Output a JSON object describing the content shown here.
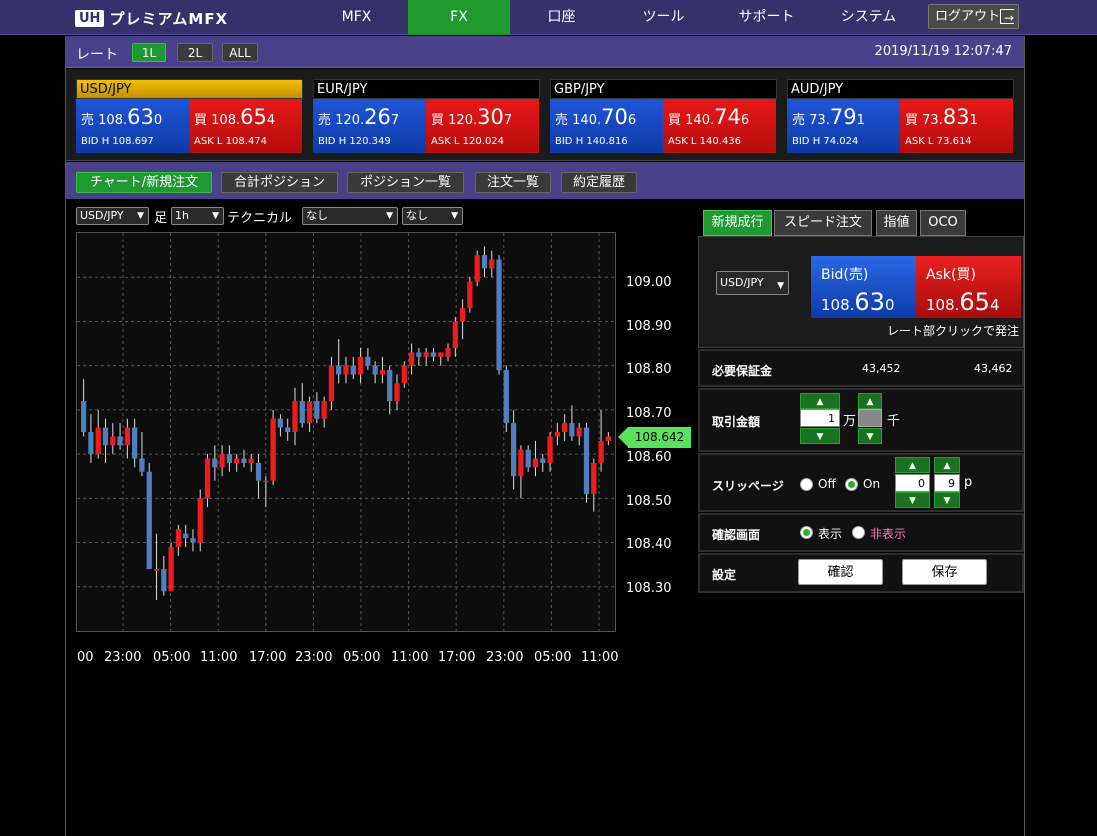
{
  "app": {
    "logo_badge": "UH",
    "logo_text": "プレミアムMFX"
  },
  "topnav": {
    "tabs": [
      {
        "label": "MFX"
      },
      {
        "label": "FX"
      },
      {
        "label": "口座"
      },
      {
        "label": "ツール"
      },
      {
        "label": "サポート"
      },
      {
        "label": "システム"
      }
    ],
    "active": "FX",
    "logout_label": "ログアウト"
  },
  "ratebar": {
    "label": "レート",
    "modes": [
      "1L",
      "2L",
      "ALL"
    ],
    "active_mode": "1L",
    "datetime": "2019/11/19 12:07:47"
  },
  "rates": [
    {
      "pair": "USD/JPY",
      "selected": true,
      "sell": {
        "prefix": "売",
        "head": "108.",
        "big": "63",
        "tail": "0"
      },
      "buy": {
        "prefix": "買",
        "head": "108.",
        "big": "65",
        "tail": "4"
      },
      "bid_high": "BID H 108.697",
      "ask_low": "ASK L 108.474"
    },
    {
      "pair": "EUR/JPY",
      "selected": false,
      "sell": {
        "prefix": "売",
        "head": "120.",
        "big": "26",
        "tail": "7"
      },
      "buy": {
        "prefix": "買",
        "head": "120.",
        "big": "30",
        "tail": "7"
      },
      "bid_high": "BID H 120.349",
      "ask_low": "ASK L 120.024"
    },
    {
      "pair": "GBP/JPY",
      "selected": false,
      "sell": {
        "prefix": "売",
        "head": "140.",
        "big": "70",
        "tail": "6"
      },
      "buy": {
        "prefix": "買",
        "head": "140.",
        "big": "74",
        "tail": "6"
      },
      "bid_high": "BID H 140.816",
      "ask_low": "ASK L 140.436"
    },
    {
      "pair": "AUD/JPY",
      "selected": false,
      "sell": {
        "prefix": "売",
        "head": "73.",
        "big": "79",
        "tail": "1"
      },
      "buy": {
        "prefix": "買",
        "head": "73.",
        "big": "83",
        "tail": "1"
      },
      "bid_high": "BID H 74.024",
      "ask_low": "ASK L 73.614"
    }
  ],
  "subnav": {
    "tabs": [
      "チャート/新規注文",
      "合計ポジション",
      "ポジション一覧",
      "注文一覧",
      "約定履歴"
    ],
    "active": "チャート/新規注文"
  },
  "chart_controls": {
    "pair": "USD/JPY",
    "bar_label": "足",
    "timeframe": "1h",
    "technical_label": "テクニカル",
    "technical_1": "なし",
    "technical_2": "なし"
  },
  "chart_data": {
    "type": "candlestick",
    "y_ticks": [
      "109.00",
      "108.90",
      "108.80",
      "108.70",
      "108.60",
      "108.50",
      "108.40",
      "108.30"
    ],
    "x_ticks": [
      "00",
      "23:00",
      "05:00",
      "11:00",
      "17:00",
      "23:00",
      "05:00",
      "11:00",
      "17:00",
      "23:00",
      "05:00",
      "11:00"
    ],
    "ylim": [
      108.2,
      109.1
    ],
    "current_price": "108.642",
    "candles": [
      {
        "o": 108.72,
        "h": 108.77,
        "l": 108.64,
        "c": 108.65
      },
      {
        "o": 108.65,
        "h": 108.69,
        "l": 108.58,
        "c": 108.6
      },
      {
        "o": 108.6,
        "h": 108.7,
        "l": 108.59,
        "c": 108.66
      },
      {
        "o": 108.66,
        "h": 108.68,
        "l": 108.58,
        "c": 108.62
      },
      {
        "o": 108.62,
        "h": 108.67,
        "l": 108.6,
        "c": 108.64
      },
      {
        "o": 108.64,
        "h": 108.67,
        "l": 108.61,
        "c": 108.62
      },
      {
        "o": 108.62,
        "h": 108.68,
        "l": 108.59,
        "c": 108.66
      },
      {
        "o": 108.66,
        "h": 108.68,
        "l": 108.57,
        "c": 108.59
      },
      {
        "o": 108.59,
        "h": 108.65,
        "l": 108.55,
        "c": 108.56
      },
      {
        "o": 108.56,
        "h": 108.58,
        "l": 108.34,
        "c": 108.34
      },
      {
        "o": 108.34,
        "h": 108.42,
        "l": 108.27,
        "c": 108.34
      },
      {
        "o": 108.34,
        "h": 108.37,
        "l": 108.28,
        "c": 108.29
      },
      {
        "o": 108.29,
        "h": 108.4,
        "l": 108.29,
        "c": 108.39
      },
      {
        "o": 108.39,
        "h": 108.44,
        "l": 108.37,
        "c": 108.43
      },
      {
        "o": 108.42,
        "h": 108.44,
        "l": 108.39,
        "c": 108.41
      },
      {
        "o": 108.41,
        "h": 108.43,
        "l": 108.38,
        "c": 108.4
      },
      {
        "o": 108.4,
        "h": 108.52,
        "l": 108.38,
        "c": 108.5
      },
      {
        "o": 108.5,
        "h": 108.6,
        "l": 108.48,
        "c": 108.59
      },
      {
        "o": 108.59,
        "h": 108.62,
        "l": 108.54,
        "c": 108.57
      },
      {
        "o": 108.57,
        "h": 108.62,
        "l": 108.55,
        "c": 108.6
      },
      {
        "o": 108.6,
        "h": 108.62,
        "l": 108.56,
        "c": 108.58
      },
      {
        "o": 108.58,
        "h": 108.6,
        "l": 108.56,
        "c": 108.59
      },
      {
        "o": 108.59,
        "h": 108.61,
        "l": 108.57,
        "c": 108.58
      },
      {
        "o": 108.58,
        "h": 108.6,
        "l": 108.56,
        "c": 108.59
      },
      {
        "o": 108.58,
        "h": 108.6,
        "l": 108.5,
        "c": 108.54
      },
      {
        "o": 108.54,
        "h": 108.55,
        "l": 108.48,
        "c": 108.54
      },
      {
        "o": 108.54,
        "h": 108.7,
        "l": 108.53,
        "c": 108.68
      },
      {
        "o": 108.68,
        "h": 108.69,
        "l": 108.64,
        "c": 108.66
      },
      {
        "o": 108.66,
        "h": 108.68,
        "l": 108.63,
        "c": 108.65
      },
      {
        "o": 108.65,
        "h": 108.75,
        "l": 108.62,
        "c": 108.72
      },
      {
        "o": 108.72,
        "h": 108.76,
        "l": 108.66,
        "c": 108.67
      },
      {
        "o": 108.67,
        "h": 108.73,
        "l": 108.65,
        "c": 108.72
      },
      {
        "o": 108.72,
        "h": 108.74,
        "l": 108.67,
        "c": 108.68
      },
      {
        "o": 108.68,
        "h": 108.73,
        "l": 108.66,
        "c": 108.72
      },
      {
        "o": 108.72,
        "h": 108.82,
        "l": 108.7,
        "c": 108.8
      },
      {
        "o": 108.8,
        "h": 108.86,
        "l": 108.76,
        "c": 108.78
      },
      {
        "o": 108.78,
        "h": 108.82,
        "l": 108.76,
        "c": 108.8
      },
      {
        "o": 108.8,
        "h": 108.82,
        "l": 108.77,
        "c": 108.78
      },
      {
        "o": 108.78,
        "h": 108.84,
        "l": 108.76,
        "c": 108.82
      },
      {
        "o": 108.82,
        "h": 108.84,
        "l": 108.79,
        "c": 108.8
      },
      {
        "o": 108.8,
        "h": 108.81,
        "l": 108.76,
        "c": 108.78
      },
      {
        "o": 108.78,
        "h": 108.82,
        "l": 108.76,
        "c": 108.79
      },
      {
        "o": 108.79,
        "h": 108.8,
        "l": 108.69,
        "c": 108.72
      },
      {
        "o": 108.72,
        "h": 108.78,
        "l": 108.7,
        "c": 108.76
      },
      {
        "o": 108.76,
        "h": 108.81,
        "l": 108.75,
        "c": 108.8
      },
      {
        "o": 108.8,
        "h": 108.85,
        "l": 108.78,
        "c": 108.83
      },
      {
        "o": 108.83,
        "h": 108.84,
        "l": 108.8,
        "c": 108.82
      },
      {
        "o": 108.82,
        "h": 108.84,
        "l": 108.8,
        "c": 108.83
      },
      {
        "o": 108.83,
        "h": 108.84,
        "l": 108.81,
        "c": 108.82
      },
      {
        "o": 108.82,
        "h": 108.83,
        "l": 108.8,
        "c": 108.83
      },
      {
        "o": 108.82,
        "h": 108.85,
        "l": 108.81,
        "c": 108.84
      },
      {
        "o": 108.84,
        "h": 108.91,
        "l": 108.82,
        "c": 108.9
      },
      {
        "o": 108.9,
        "h": 108.95,
        "l": 108.86,
        "c": 108.93
      },
      {
        "o": 108.93,
        "h": 109.0,
        "l": 108.92,
        "c": 108.99
      },
      {
        "o": 108.99,
        "h": 109.06,
        "l": 108.98,
        "c": 109.05
      },
      {
        "o": 109.05,
        "h": 109.07,
        "l": 109.0,
        "c": 109.02
      },
      {
        "o": 109.02,
        "h": 109.06,
        "l": 109.0,
        "c": 109.04
      },
      {
        "o": 109.04,
        "h": 109.05,
        "l": 108.78,
        "c": 108.79
      },
      {
        "o": 108.79,
        "h": 108.8,
        "l": 108.65,
        "c": 108.67
      },
      {
        "o": 108.67,
        "h": 108.7,
        "l": 108.52,
        "c": 108.55
      },
      {
        "o": 108.55,
        "h": 108.62,
        "l": 108.5,
        "c": 108.61
      },
      {
        "o": 108.61,
        "h": 108.62,
        "l": 108.56,
        "c": 108.57
      },
      {
        "o": 108.57,
        "h": 108.63,
        "l": 108.55,
        "c": 108.59
      },
      {
        "o": 108.59,
        "h": 108.6,
        "l": 108.56,
        "c": 108.58
      },
      {
        "o": 108.58,
        "h": 108.65,
        "l": 108.56,
        "c": 108.64
      },
      {
        "o": 108.64,
        "h": 108.67,
        "l": 108.62,
        "c": 108.65
      },
      {
        "o": 108.65,
        "h": 108.69,
        "l": 108.63,
        "c": 108.67
      },
      {
        "o": 108.67,
        "h": 108.71,
        "l": 108.63,
        "c": 108.64
      },
      {
        "o": 108.64,
        "h": 108.67,
        "l": 108.62,
        "c": 108.66
      },
      {
        "o": 108.66,
        "h": 108.67,
        "l": 108.49,
        "c": 108.51
      },
      {
        "o": 108.51,
        "h": 108.59,
        "l": 108.47,
        "c": 108.58
      },
      {
        "o": 108.58,
        "h": 108.7,
        "l": 108.56,
        "c": 108.63
      },
      {
        "o": 108.63,
        "h": 108.65,
        "l": 108.62,
        "c": 108.64
      }
    ]
  },
  "order_panel": {
    "tabs": [
      "新規成行",
      "スピード注文",
      "指値",
      "OCO"
    ],
    "active": "新規成行",
    "pair": "USD/JPY",
    "bid_label": "Bid(売)",
    "ask_label": "Ask(買)",
    "bid_price": {
      "head": "108.",
      "big": "63",
      "tail": "0"
    },
    "ask_price": {
      "head": "108.",
      "big": "65",
      "tail": "4"
    },
    "hint": "レート部クリックで発注",
    "margin_label": "必要保証金",
    "margin_bid": "43,452",
    "margin_ask": "43,462",
    "amount_label": "取引金額",
    "amount_value": "1",
    "amount_unit_man": "万",
    "amount_unit_sen": "千",
    "slippage_label": "スリッページ",
    "slip_off": "Off",
    "slip_on": "On",
    "slip_value_1": "0",
    "slip_value_2": "9",
    "slip_unit": "p",
    "confirm_label": "確認画面",
    "confirm_show": "表示",
    "confirm_hide": "非表示",
    "settings_label": "設定",
    "confirm_btn": "確認",
    "save_btn": "保存",
    "colors": {
      "accent": "#1f9a30",
      "bid": "#0d3aa8",
      "ask": "#b50c0c",
      "hide_text": "#ff77b3"
    }
  }
}
